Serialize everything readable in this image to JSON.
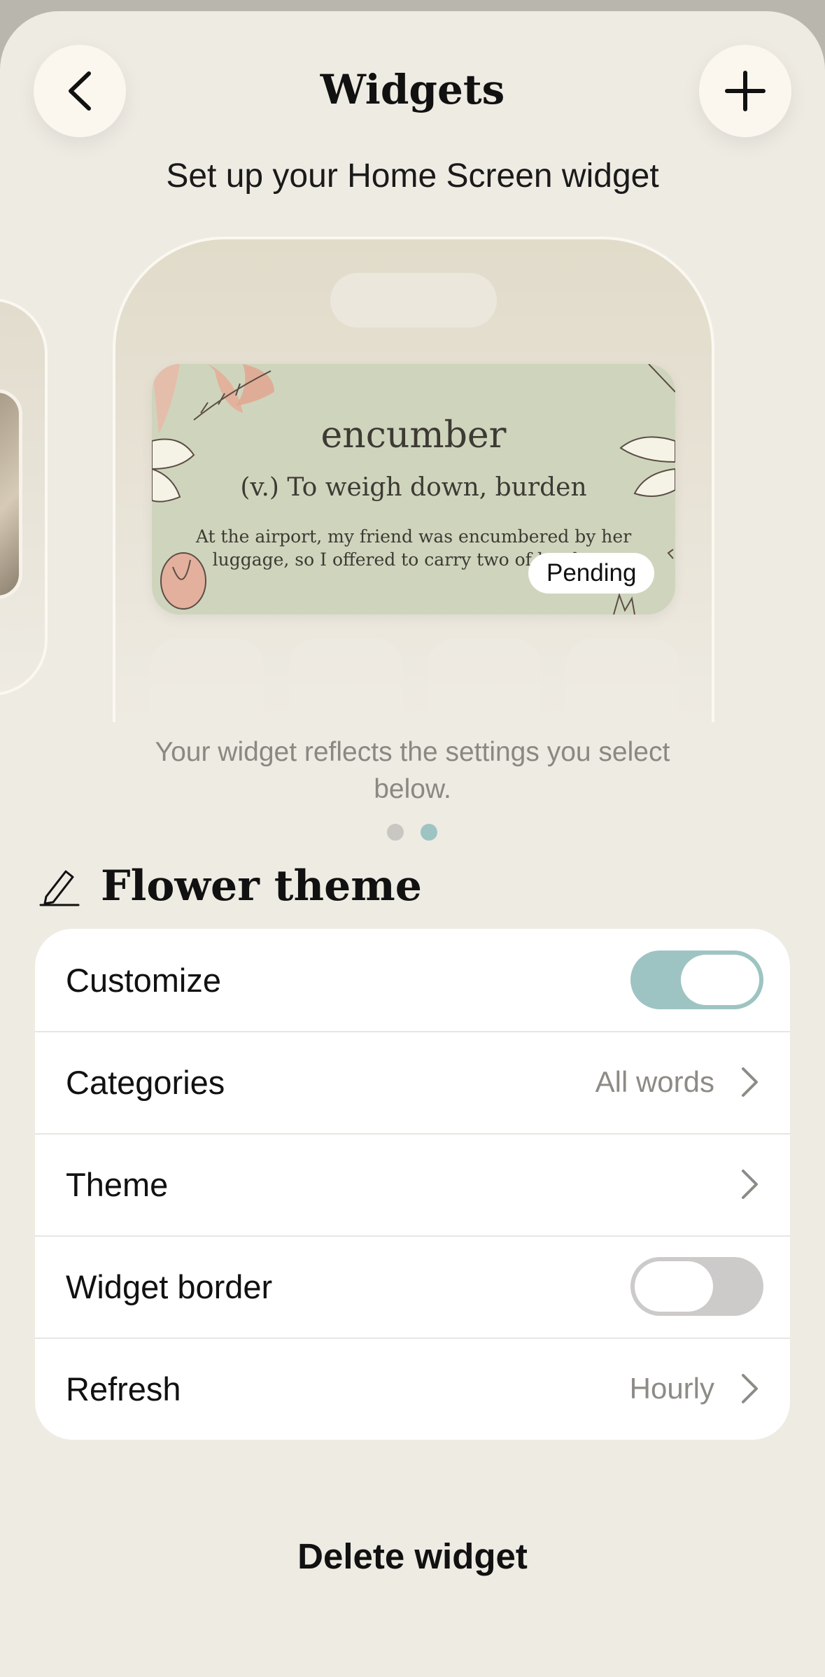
{
  "header": {
    "title": "Widgets",
    "subtitle": "Set up your Home Screen widget",
    "back_icon": "chevron-left-icon",
    "add_icon": "plus-icon"
  },
  "preview": {
    "widget": {
      "word": "encumber",
      "definition": "(v.) To weigh down, burden",
      "example": "At the airport, my friend was encumbered by her luggage, so I offered to carry two of her bags",
      "status": "Pending"
    },
    "hint": "Your widget reflects the settings you select below.",
    "pages": {
      "count": 2,
      "active": 2
    }
  },
  "section": {
    "icon": "pencil-icon",
    "title": "Flower theme"
  },
  "settings": {
    "customize": {
      "label": "Customize",
      "on": true
    },
    "categories": {
      "label": "Categories",
      "value": "All words"
    },
    "theme": {
      "label": "Theme"
    },
    "widget_border": {
      "label": "Widget border",
      "on": false
    },
    "refresh": {
      "label": "Refresh",
      "value": "Hourly"
    }
  },
  "delete_label": "Delete widget",
  "colors": {
    "background": "#eeebe3",
    "toggle_on": "#9dc4c2",
    "toggle_off": "#cdcbca",
    "widget": "#cfd5bd",
    "dot_active": "#9dc4c2",
    "dot_inactive": "#c9c7c2"
  }
}
